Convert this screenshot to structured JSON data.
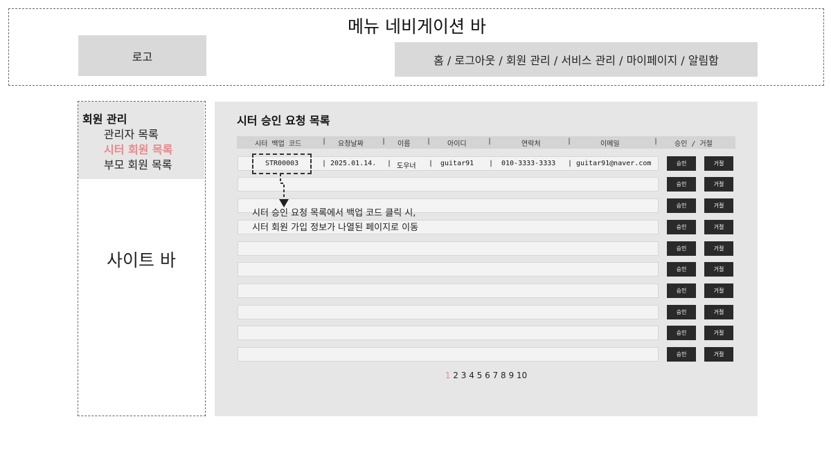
{
  "navbar": {
    "title": "메뉴 네비게이션 바",
    "logo": "로고",
    "menu": "홈 / 로그아웃 / 회원 관리 / 서비스 관리 / 마이페이지 / 알림함"
  },
  "sidebar": {
    "heading": "회원 관리",
    "items": [
      "관리자 목록",
      "시터 회원 목록",
      "부모 회원 목록"
    ],
    "active_item": "시터 회원 목록",
    "title": "사이트 바"
  },
  "main": {
    "title": "시터 승인 요청 목록",
    "columns": [
      "시터 백업 코드",
      "요청날짜",
      "이름",
      "아이디",
      "연락처",
      "이메일",
      "승인 / 거절"
    ],
    "rows": [
      {
        "code": "STR00003",
        "date": "2025.01.14.",
        "name": "도우너",
        "id": "guitar91",
        "phone": "010-3333-3333",
        "email": "guitar91@naver.com"
      }
    ],
    "approve_label": "승인",
    "reject_label": "거절",
    "annotation": [
      "시터 승인 요청 목록에서 백업 코드 클릭 시,",
      "시터 회원 가입 정보가 나열된 페이지로 이동"
    ],
    "pagination": {
      "active": "1",
      "rest": "2 3 4 5 6 7 8 9 10"
    }
  },
  "colors": {
    "accent": "#e8888a",
    "panel": "#e6e6e6",
    "button": "#2a2a2a"
  }
}
